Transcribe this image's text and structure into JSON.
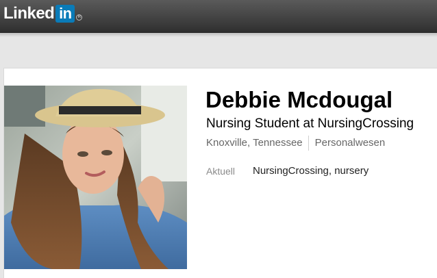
{
  "header": {
    "logo_text": "Linked",
    "logo_box_text": "in",
    "logo_registered": "R"
  },
  "profile": {
    "name": "Debbie Mcdougal",
    "headline": "Nursing Student at NursingCrossing",
    "location": "Knoxville, Tennessee",
    "industry": "Personalwesen",
    "current_label": "Aktuell",
    "current_value": "NursingCrossing, nursery"
  },
  "colors": {
    "topbar": "#434343",
    "brand_blue": "#0a7bb8",
    "background": "#e6e6e6",
    "card": "#ffffff"
  }
}
